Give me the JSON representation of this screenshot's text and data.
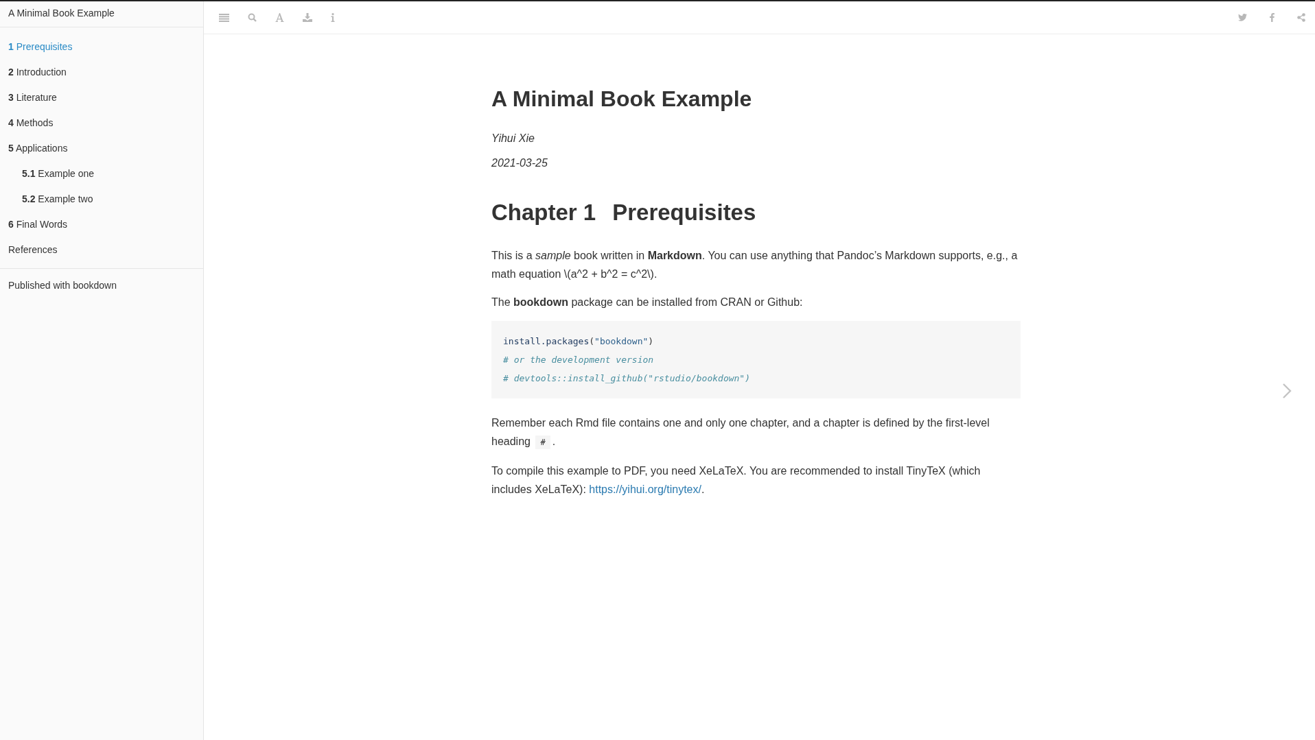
{
  "sidebar": {
    "title": "A Minimal Book Example",
    "items": [
      {
        "number": "1",
        "label": "Prerequisites",
        "selected": true
      },
      {
        "number": "2",
        "label": "Introduction",
        "selected": false
      },
      {
        "number": "3",
        "label": "Literature",
        "selected": false
      },
      {
        "number": "4",
        "label": "Methods",
        "selected": false
      },
      {
        "number": "5",
        "label": "Applications",
        "selected": false,
        "children": [
          {
            "number": "5.1",
            "label": "Example one",
            "selected": false
          },
          {
            "number": "5.2",
            "label": "Example two",
            "selected": false
          }
        ]
      },
      {
        "number": "6",
        "label": "Final Words",
        "selected": false
      },
      {
        "label": "References",
        "selected": false
      }
    ],
    "footer": "Published with bookdown"
  },
  "content": {
    "title": "A Minimal Book Example",
    "author": "Yihui Xie",
    "date": "2021-03-25",
    "chapter": {
      "label": "Chapter 1",
      "title": "Prerequisites"
    },
    "blocks": [
      {
        "kind": "paragraph",
        "segments": [
          {
            "kind": "text",
            "text": "This is a *sample* book written in **Markdown**. You can use anything that Pandoc’s Markdown supports, e.g., a math equation \\(a^2 + b^2 = c^2\\)."
          }
        ]
      },
      {
        "kind": "paragraph",
        "segments": [
          {
            "kind": "text",
            "text": "The **bookdown** package can be installed from CRAN or Github:"
          }
        ]
      },
      {
        "kind": "code",
        "lines": [
          [
            {
              "kind": "function",
              "text": "install.packages"
            },
            {
              "kind": "plain",
              "text": "("
            },
            {
              "kind": "string",
              "text": "\"bookdown\""
            },
            {
              "kind": "plain",
              "text": ")"
            }
          ],
          [
            {
              "kind": "comment",
              "text": "# or the development version"
            }
          ],
          [
            {
              "kind": "comment",
              "text": "# devtools::install_github(\"rstudio/bookdown\")"
            }
          ]
        ]
      },
      {
        "kind": "paragraph",
        "segments": [
          {
            "kind": "text",
            "text": "Remember each Rmd file contains one and only one chapter, and a chapter is defined by the first-level heading "
          },
          {
            "kind": "code",
            "text": "#"
          },
          {
            "kind": "text",
            "text": "."
          }
        ]
      },
      {
        "kind": "paragraph",
        "segments": [
          {
            "kind": "text",
            "text": "To compile this example to PDF, you need XeLaTeX. You are recommended to install TinyTeX (which includes XeLaTeX): "
          },
          {
            "kind": "link",
            "text": "https://yihui.org/tinytex/"
          },
          {
            "kind": "text",
            "text": "."
          }
        ]
      }
    ]
  }
}
